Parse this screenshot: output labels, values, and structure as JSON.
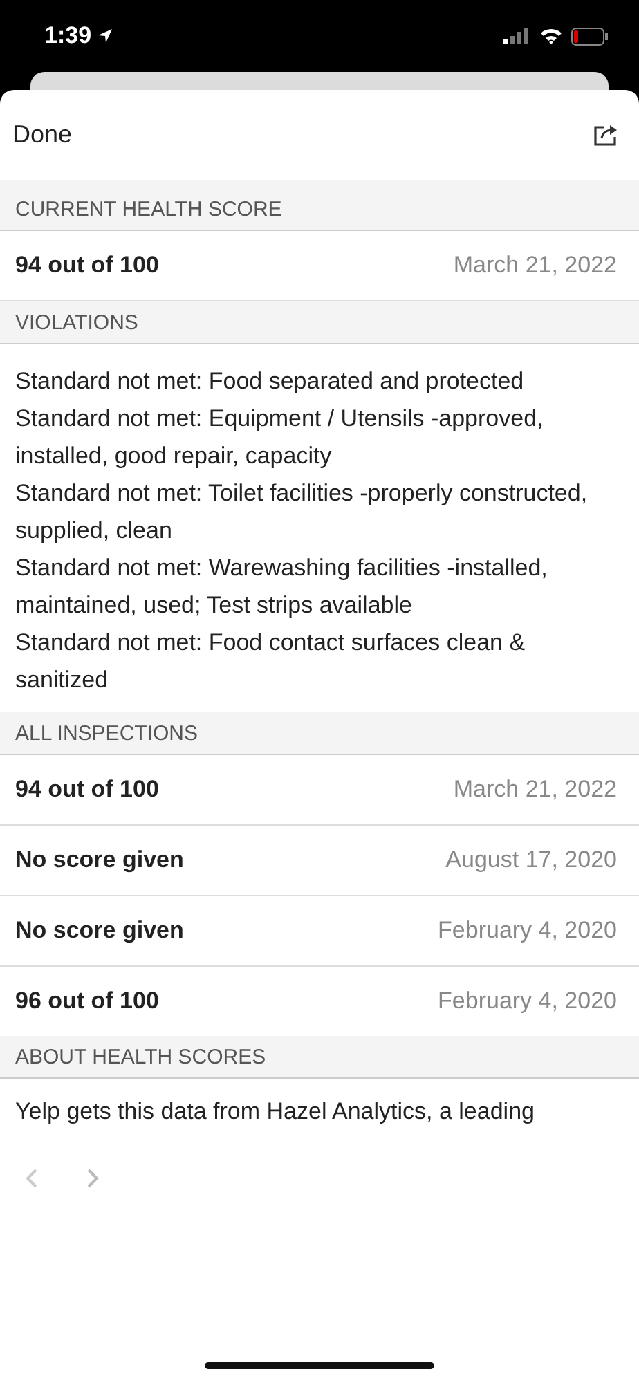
{
  "status_bar": {
    "time": "1:39"
  },
  "header": {
    "done": "Done"
  },
  "current_health_score": {
    "title": "CURRENT HEALTH SCORE",
    "score": "94 out of 100",
    "date": "March 21, 2022"
  },
  "violations": {
    "title": "VIOLATIONS",
    "items": [
      "Standard not met: Food separated and protected",
      "Standard not met: Equipment / Utensils -approved, installed, good repair, capacity",
      "Standard not met: Toilet facilities -properly constructed, supplied, clean",
      "Standard not met: Warewashing facilities -installed, maintained, used; Test strips available",
      "Standard not met: Food contact surfaces clean & sanitized"
    ]
  },
  "all_inspections": {
    "title": "ALL INSPECTIONS",
    "rows": [
      {
        "score": "94 out of 100",
        "date": "March 21, 2022"
      },
      {
        "score": "No score given",
        "date": "August 17, 2020"
      },
      {
        "score": "No score given",
        "date": "February 4, 2020"
      },
      {
        "score": "96 out of 100",
        "date": "February 4, 2020"
      }
    ]
  },
  "about_health_scores": {
    "title": "ABOUT HEALTH SCORES",
    "text": "Yelp gets this data from Hazel Analytics, a leading"
  }
}
